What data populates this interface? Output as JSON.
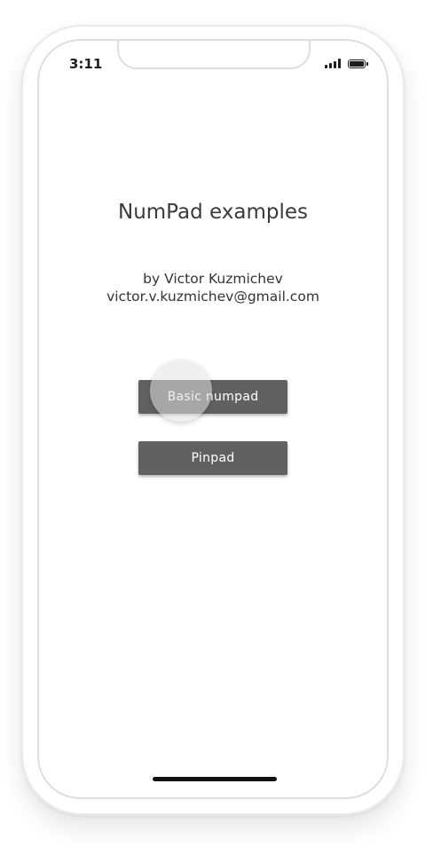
{
  "status_bar": {
    "time": "3:11",
    "signal_icon": "cellular-signal-icon",
    "battery_icon": "battery-full-icon"
  },
  "main": {
    "title": "NumPad examples",
    "author_line": "by Victor Kuzmichev",
    "email_line": "victor.v.kuzmichev@gmail.com"
  },
  "buttons": {
    "basic_numpad_label": "Basic numpad",
    "pinpad_label": "Pinpad"
  },
  "colors": {
    "button_background": "#616161",
    "button_text": "#ffffff",
    "title_text": "#3a3a3a"
  }
}
